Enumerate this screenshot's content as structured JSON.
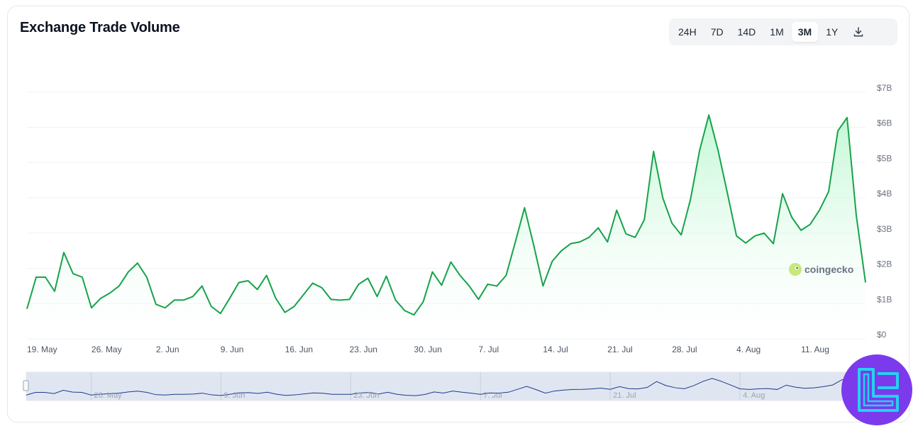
{
  "header": {
    "title": "Exchange Trade Volume"
  },
  "range_buttons": [
    {
      "label": "24H",
      "active": false
    },
    {
      "label": "7D",
      "active": false
    },
    {
      "label": "14D",
      "active": false
    },
    {
      "label": "1M",
      "active": false
    },
    {
      "label": "3M",
      "active": true
    },
    {
      "label": "1Y",
      "active": false
    }
  ],
  "download_icon": "download-icon",
  "watermark": "coingecko",
  "colors": {
    "line": "#16a34a",
    "fill_top": "#bbf7d0",
    "grid": "#eef0f3",
    "navigator_bg": "#dde3f0",
    "navigator_line": "#1e3a8a",
    "badge": "#7c3aed",
    "badge_accent": "#22d3ee"
  },
  "chart_data": {
    "type": "area",
    "title": "Exchange Trade Volume",
    "xlabel": "",
    "ylabel": "",
    "ylim": [
      0,
      7
    ],
    "y_unit": "B USD",
    "y_ticks": [
      "$0",
      "$1B",
      "$2B",
      "$3B",
      "$4B",
      "$5B",
      "$6B",
      "$7B"
    ],
    "x_ticks": [
      "19. May",
      "26. May",
      "2. Jun",
      "9. Jun",
      "16. Jun",
      "23. Jun",
      "30. Jun",
      "7. Jul",
      "14. Jul",
      "21. Jul",
      "28. Jul",
      "4. Aug",
      "11. Aug"
    ],
    "navigator_ticks": [
      "26. May",
      "9. Jun",
      "23. Jun",
      "7. Jul",
      "21. Jul",
      "4. Aug"
    ],
    "grid": true,
    "legend": "none",
    "series": [
      {
        "values": [
          0.85,
          1.75,
          1.75,
          1.35,
          2.45,
          1.85,
          1.75,
          0.88,
          1.15,
          1.3,
          1.5,
          1.9,
          2.15,
          1.75,
          0.98,
          0.88,
          1.1,
          1.1,
          1.2,
          1.5,
          0.92,
          0.72,
          1.15,
          1.6,
          1.65,
          1.4,
          1.8,
          1.15,
          0.75,
          0.92,
          1.25,
          1.58,
          1.45,
          1.12,
          1.1,
          1.12,
          1.55,
          1.72,
          1.2,
          1.78,
          1.1,
          0.8,
          0.68,
          1.05,
          1.9,
          1.52,
          2.18,
          1.8,
          1.5,
          1.12,
          1.55,
          1.5,
          1.8,
          2.75,
          3.72,
          2.65,
          1.5,
          2.2,
          2.5,
          2.7,
          2.75,
          2.88,
          3.15,
          2.75,
          3.65,
          2.98,
          2.88,
          3.38,
          5.32,
          4.0,
          3.28,
          2.95,
          3.95,
          5.35,
          6.35,
          5.35,
          4.15,
          2.92,
          2.72,
          2.92,
          3.0,
          2.7,
          4.12,
          3.45,
          3.08,
          3.25,
          3.65,
          4.18,
          5.9,
          6.28,
          3.5,
          1.6
        ]
      }
    ]
  }
}
